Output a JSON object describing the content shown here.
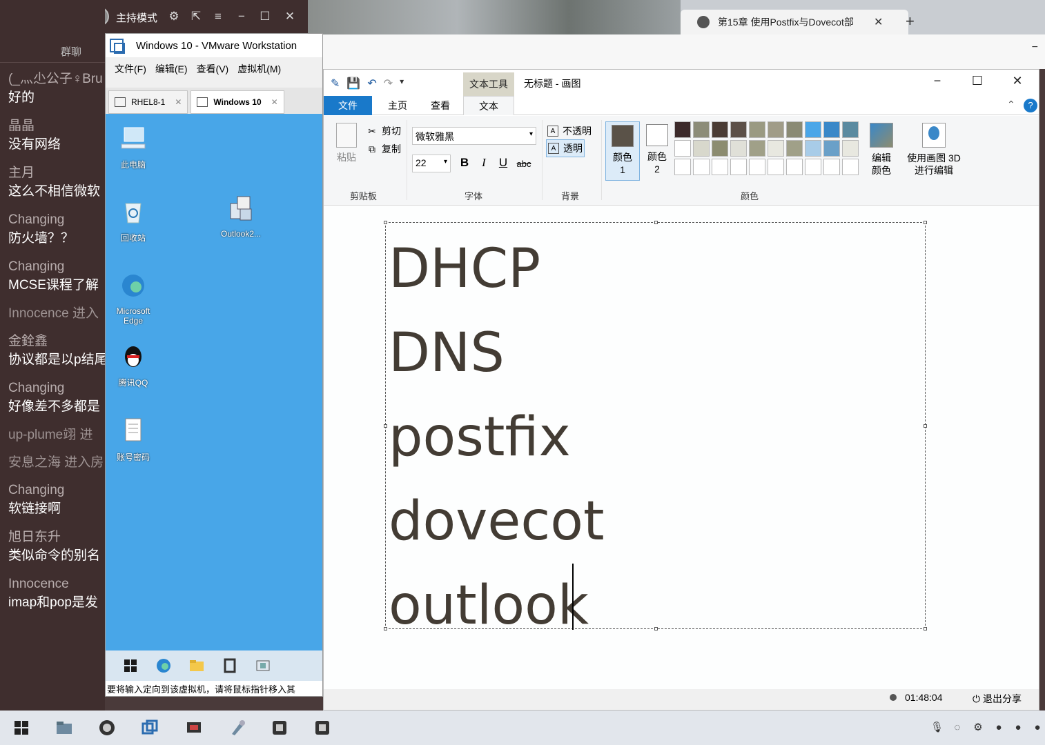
{
  "chat": {
    "mode_label": "主持模式",
    "tab_label": "群聊",
    "messages": [
      {
        "name": "(_灬尐公子♀Bru",
        "text": "好的"
      },
      {
        "name": "晶晶",
        "text": "没有网络"
      },
      {
        "name": "主月",
        "text": "这么不相信微软"
      },
      {
        "name": "Changing",
        "text": "防火墙？？"
      },
      {
        "name": "Changing",
        "text": "MCSE课程了解"
      },
      {
        "name": "Innocence 进入",
        "text": ""
      },
      {
        "name": "金銓鑫",
        "text": "协议都是以p结尾"
      },
      {
        "name": "Changing",
        "text": "好像差不多都是"
      },
      {
        "name": "up-plume翊 进",
        "text": ""
      },
      {
        "name": "安息之海 进入房",
        "text": ""
      },
      {
        "name": "Changing",
        "text": "软链接啊"
      },
      {
        "name": "旭日东升",
        "text": "类似命令的别名"
      },
      {
        "name": "Innocence",
        "text": "imap和pop是发"
      }
    ]
  },
  "browser": {
    "tab_title": "第15章 使用Postfix与Dovecot部",
    "close": "✕",
    "new_tab": "+"
  },
  "vmware": {
    "title": "Windows 10 - VMware Workstation",
    "menus": [
      "文件(F)",
      "编辑(E)",
      "查看(V)",
      "虚拟机(M)"
    ],
    "tabs": [
      {
        "label": "RHEL8-1"
      },
      {
        "label": "Windows 10"
      }
    ],
    "desktop_icons": [
      {
        "label": "此电脑"
      },
      {
        "label": "回收站"
      },
      {
        "label": "Outlook2..."
      },
      {
        "label": "Microsoft Edge"
      },
      {
        "label": "腾讯QQ"
      },
      {
        "label": "账号密码"
      }
    ],
    "status_text": "要将输入定向到该虚拟机，请将鼠标指针移入其"
  },
  "paint": {
    "context_tab": "文本工具",
    "title": "无标题 - 画图",
    "tabs": [
      "文件",
      "主页",
      "查看",
      "文本"
    ],
    "clipboard": {
      "paste": "粘贴",
      "cut": "剪切",
      "copy": "复制",
      "group": "剪贴板"
    },
    "font": {
      "family": "微软雅黑",
      "size": "22",
      "group": "字体"
    },
    "background": {
      "opaque": "不透明",
      "transparent": "透明",
      "group": "背景"
    },
    "colors": {
      "color1": "颜色 1",
      "color2": "颜色 2",
      "edit": "编辑颜色",
      "paint3d": "使用画图 3D 进行编辑",
      "group": "颜色"
    },
    "palette": [
      "#3c2a2a",
      "#8c8c78",
      "#4a3c34",
      "#5c5048",
      "#9a9a82",
      "#a09c88",
      "#8a8a74",
      "#4aa6e8",
      "#3a88c8",
      "#5a8aa0",
      "#ffffff",
      "#d8d8cc",
      "#8c8c70",
      "#e0e0d8",
      "#a0a088",
      "#e8e8e0",
      "#a0a088",
      "#a8cce8",
      "#6aa0c8",
      "#e8e8e0",
      "#ffffff",
      "#ffffff",
      "#ffffff",
      "#ffffff",
      "#ffffff",
      "#ffffff",
      "#ffffff",
      "#ffffff",
      "#ffffff",
      "#ffffff"
    ],
    "color1_hex": "#5a5248",
    "color2_hex": "#ffffff",
    "canvas_lines": [
      "DHCP",
      "DNS",
      "postfix",
      "dovecot",
      "outlook"
    ],
    "timer": "01:48:04",
    "exit_share": "退出分享"
  },
  "host_taskbar": {
    "icons": [
      "windows-start-icon",
      "file-explorer-icon",
      "obs-icon",
      "vmware-icon",
      "screen-share-icon",
      "paint-icon",
      "app-icon-1",
      "app-icon-2"
    ]
  }
}
